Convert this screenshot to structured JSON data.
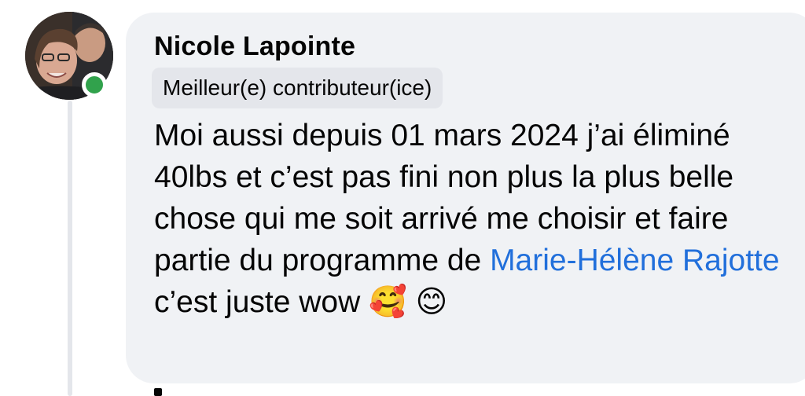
{
  "comment": {
    "author": "Nicole Lapointe",
    "badge": "Meilleur(e) contributeur(ice)",
    "text_before_mention": "Moi aussi depuis 01 mars 2024 j’ai éliminé 40lbs et c’est pas fini non plus la plus belle chose qui me soit arrivé me choisir et faire partie du programme de ",
    "mention": "Marie-Hélène Rajotte",
    "text_after_mention": "c’est juste wow ",
    "emoji_1": "🥰",
    "emoji_2": "😊",
    "online_status_color": "#31a24c",
    "mention_color": "#216fdb"
  }
}
